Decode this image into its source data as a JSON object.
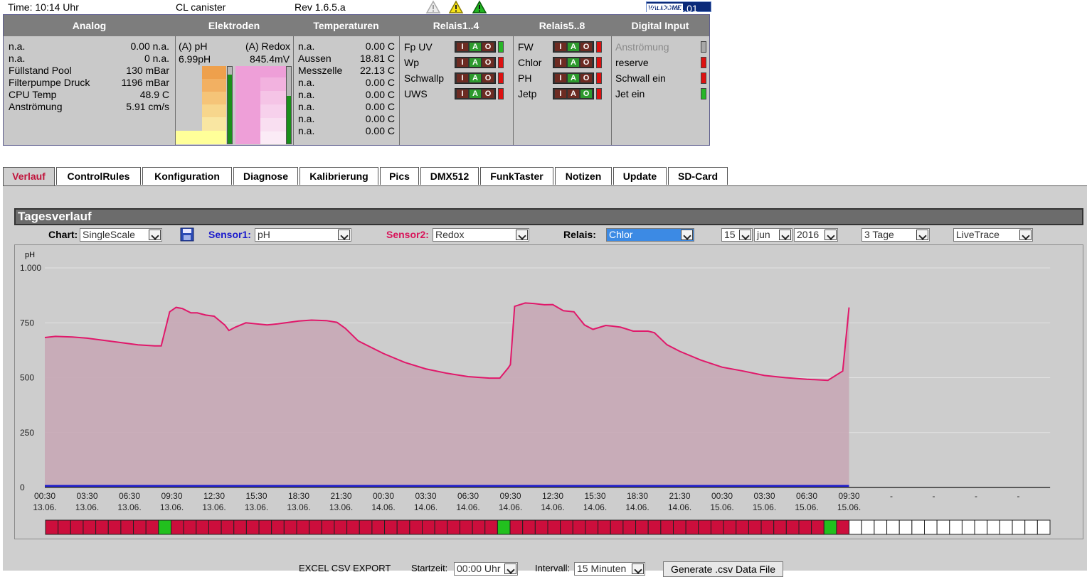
{
  "topbar": {
    "time": "Time: 10:14 Uhr",
    "name": "CL canister",
    "rev": "Rev 1.6.5.a",
    "valid_badge_1": "VALIDOME",
    "valid_badge_2": "HTML 4.01"
  },
  "panel": {
    "headers": [
      "Analog",
      "Elektroden",
      "Temperaturen",
      "Relais1..4",
      "Relais5..8",
      "Digital Input"
    ],
    "analog": [
      {
        "label": "n.a.",
        "value": "0.00 n.a."
      },
      {
        "label": "n.a.",
        "value": "0 n.a."
      },
      {
        "label": "Füllstand Pool",
        "value": "130 mBar"
      },
      {
        "label": "Filterpumpe Druck",
        "value": "1196 mBar"
      },
      {
        "label": "CPU Temp",
        "value": "48.9 C"
      },
      {
        "label": "Anströmung",
        "value": "5.91 cm/s"
      }
    ],
    "elektroden": {
      "ph_label": "(A) pH",
      "ph_value": "6.99pH",
      "redox_label": "(A) Redox",
      "redox_value": "845.4mV"
    },
    "temperaturen": [
      {
        "label": "n.a.",
        "value": "0.00 C"
      },
      {
        "label": "Aussen",
        "value": "18.81 C"
      },
      {
        "label": "Messzelle",
        "value": "22.13 C"
      },
      {
        "label": "n.a.",
        "value": "0.00 C"
      },
      {
        "label": "n.a.",
        "value": "0.00 C"
      },
      {
        "label": "n.a.",
        "value": "0.00 C"
      },
      {
        "label": "n.a.",
        "value": "0.00 C"
      },
      {
        "label": "n.a.",
        "value": "0.00 C"
      }
    ],
    "relais1": [
      {
        "label": "Fp UV",
        "active": "A",
        "led": "g"
      },
      {
        "label": "Wp",
        "active": "A",
        "led": "r"
      },
      {
        "label": "Schwallp",
        "active": "A",
        "led": "r"
      },
      {
        "label": "UWS",
        "active": "A",
        "led": "r"
      }
    ],
    "relais2": [
      {
        "label": "FW",
        "active": "A",
        "led": "r"
      },
      {
        "label": "Chlor",
        "active": "A",
        "led": "r"
      },
      {
        "label": "PH",
        "active": "A",
        "led": "r"
      },
      {
        "label": "Jetp",
        "active": "O",
        "led": "r"
      }
    ],
    "iao_letters": [
      "I",
      "A",
      "O"
    ],
    "digital": [
      {
        "label": "Anströmung",
        "led": "gray",
        "dim": true
      },
      {
        "label": "reserve",
        "led": "r",
        "dim": false
      },
      {
        "label": "Schwall ein",
        "led": "r",
        "dim": false
      },
      {
        "label": "Jet ein",
        "led": "g",
        "dim": false
      }
    ]
  },
  "tabs": [
    "Verlauf",
    "ControlRules",
    "Konfiguration",
    "Diagnose",
    "Kalibrierung",
    "Pics",
    "DMX512",
    "FunkTaster",
    "Notizen",
    "Update",
    "SD-Card"
  ],
  "active_tab": "Verlauf",
  "section_title": "Tagesverlauf",
  "controls": {
    "chart_label": "Chart:",
    "chart_value": "SingleScale",
    "sensor1_label": "Sensor1:",
    "sensor1_value": "pH",
    "sensor2_label": "Sensor2:",
    "sensor2_value": "Redox",
    "relais_label": "Relais:",
    "relais_value": "Chlor",
    "day": "15",
    "month": "jun",
    "year": "2016",
    "range": "3 Tage",
    "mode": "LiveTrace",
    "sensor1_color": "#1a1acc",
    "sensor2_color": "#d8145a"
  },
  "bottom": {
    "export_label": "EXCEL CSV EXPORT",
    "start_label": "Startzeit:",
    "start_value": "00:00 Uhr",
    "interval_label": "Intervall:",
    "interval_value": "15 Minuten",
    "generate_button": "Generate .csv Data File"
  },
  "chart_data": {
    "type": "area",
    "ylabel": "pH",
    "ylim": [
      0,
      1000
    ],
    "yticks": [
      "0",
      "250",
      "500",
      "750",
      "1.000"
    ],
    "xticks": [
      [
        "00:30",
        "13.06."
      ],
      [
        "03:30",
        "13.06."
      ],
      [
        "06:30",
        "13.06."
      ],
      [
        "09:30",
        "13.06."
      ],
      [
        "12:30",
        "13.06."
      ],
      [
        "15:30",
        "13.06."
      ],
      [
        "18:30",
        "13.06."
      ],
      [
        "21:30",
        "13.06."
      ],
      [
        "00:30",
        "14.06."
      ],
      [
        "03:30",
        "14.06."
      ],
      [
        "06:30",
        "14.06."
      ],
      [
        "09:30",
        "14.06."
      ],
      [
        "12:30",
        "14.06."
      ],
      [
        "15:30",
        "14.06."
      ],
      [
        "18:30",
        "14.06."
      ],
      [
        "21:30",
        "14.06."
      ],
      [
        "00:30",
        "15.06."
      ],
      [
        "03:30",
        "15.06."
      ],
      [
        "06:30",
        "15.06."
      ],
      [
        "09:30",
        "15.06."
      ],
      [
        "-",
        ""
      ],
      [
        "-",
        ""
      ],
      [
        "-",
        ""
      ],
      [
        "-",
        ""
      ]
    ],
    "series": [
      {
        "color": "#e0186a",
        "x_tick_index": [
          0,
          0.25,
          0.65,
          1,
          1.4,
          1.8,
          2.2,
          2.6,
          2.75,
          2.95,
          3.1,
          3.25,
          3.45,
          3.6,
          3.8,
          4.0,
          4.25,
          4.35,
          4.5,
          4.75,
          5.0,
          5.25,
          5.5,
          6.0,
          6.3,
          6.65,
          6.9,
          7.1,
          7.4,
          8.0,
          8.5,
          9.0,
          9.5,
          10.0,
          10.5,
          10.75,
          10.95,
          11.0,
          11.1,
          11.35,
          11.55,
          11.8,
          12.0,
          12.25,
          12.5,
          12.75,
          12.95,
          13.25,
          13.4,
          13.6,
          13.9,
          14.25,
          14.4,
          14.7,
          15.0,
          15.5,
          16.0,
          16.5,
          17.0,
          17.5,
          18.0,
          18.5,
          18.85,
          19.0
        ],
        "values": [
          683,
          688,
          685,
          680,
          670,
          660,
          650,
          645,
          645,
          800,
          820,
          815,
          795,
          795,
          785,
          780,
          740,
          715,
          730,
          750,
          745,
          740,
          745,
          758,
          762,
          760,
          752,
          725,
          668,
          610,
          570,
          540,
          520,
          505,
          498,
          498,
          545,
          560,
          825,
          840,
          838,
          832,
          833,
          805,
          800,
          740,
          720,
          738,
          735,
          730,
          712,
          712,
          705,
          650,
          620,
          580,
          548,
          530,
          510,
          500,
          493,
          488,
          530,
          820
        ]
      },
      {
        "color": "#1a1acc",
        "x_tick_index": [
          0,
          19.0
        ],
        "values": [
          6.99,
          6.99
        ]
      }
    ],
    "relais_track": {
      "segments_total": 80,
      "data_segments": 64,
      "on_segments": [
        9,
        36,
        62
      ],
      "off_color": "#cc0e3c",
      "on_color": "#22c01e",
      "empty_color": "#ffffff"
    }
  }
}
